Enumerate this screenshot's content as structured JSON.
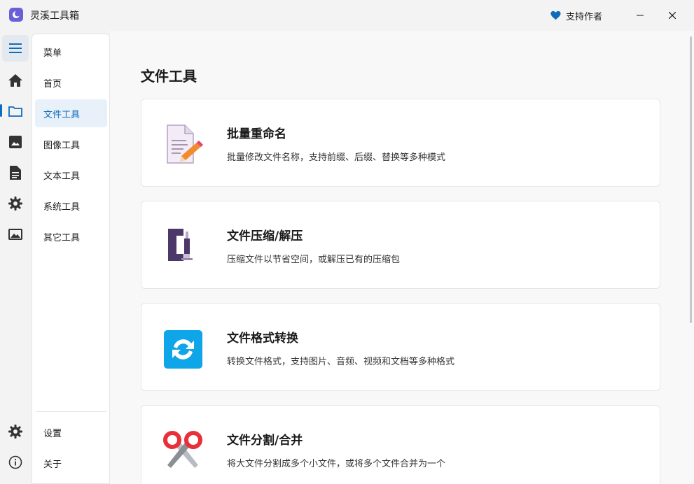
{
  "app": {
    "title": "灵溪工具箱",
    "support_label": "支持作者",
    "accent_color": "#0f6cbd"
  },
  "rail": {
    "icons": [
      "menu-icon",
      "home-icon",
      "folder-icon",
      "image-icon",
      "document-icon",
      "gear-icon",
      "picture-icon",
      "settings-gear-icon",
      "info-icon"
    ]
  },
  "nav": {
    "header": "菜单",
    "items": [
      {
        "label": "首页"
      },
      {
        "label": "文件工具",
        "selected": true
      },
      {
        "label": "图像工具"
      },
      {
        "label": "文本工具"
      },
      {
        "label": "系统工具"
      },
      {
        "label": "其它工具"
      }
    ],
    "footer": [
      {
        "label": "设置"
      },
      {
        "label": "关于"
      }
    ]
  },
  "main": {
    "title": "文件工具",
    "cards": [
      {
        "title": "批量重命名",
        "desc": "批量修改文件名称，支持前缀、后缀、替换等多种模式",
        "icon": "rename-document-icon"
      },
      {
        "title": "文件压缩/解压",
        "desc": "压缩文件以节省空间，或解压已有的压缩包",
        "icon": "clamp-icon"
      },
      {
        "title": "文件格式转换",
        "desc": "转换文件格式，支持图片、音频、视频和文档等多种格式",
        "icon": "convert-icon"
      },
      {
        "title": "文件分割/合并",
        "desc": "将大文件分割成多个小文件，或将多个文件合并为一个",
        "icon": "scissors-icon"
      }
    ]
  }
}
